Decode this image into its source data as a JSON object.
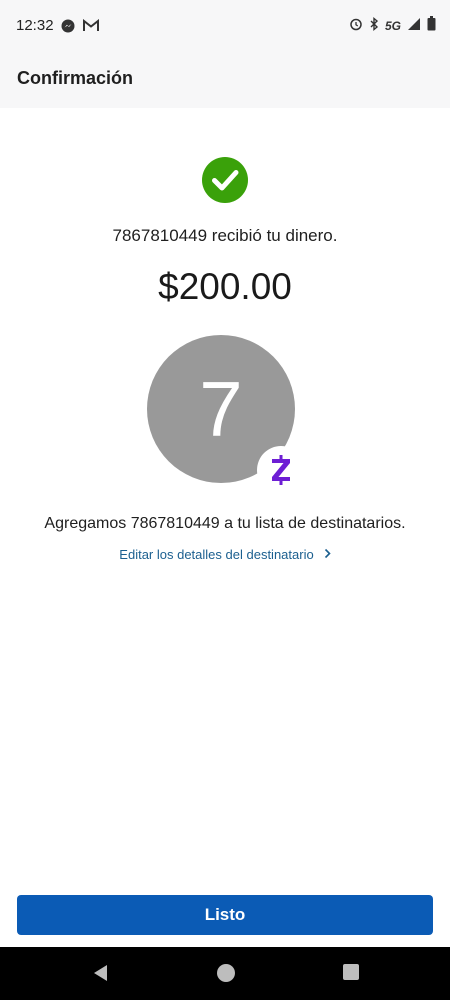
{
  "status_bar": {
    "time": "12:32",
    "left_icons": [
      "messenger-icon",
      "gmail-icon"
    ],
    "network": "5G",
    "right_icons": [
      "alarm-icon",
      "bluetooth-icon",
      "signal-icon",
      "battery-icon"
    ]
  },
  "header": {
    "title": "Confirmación"
  },
  "confirmation": {
    "icon": "check-circle-icon",
    "received_text": "7867810449 recibió tu dinero.",
    "amount": "$200.00",
    "avatar_initial": "7",
    "badge_icon": "zelle-icon",
    "added_text": "Agregamos 7867810449 a tu lista de destinatarios.",
    "edit_link_label": "Editar los detalles del destinatario"
  },
  "footer": {
    "done_label": "Listo"
  },
  "colors": {
    "success": "#3aa10a",
    "primary_button": "#0b5bb5",
    "link": "#1b5f8f",
    "zelle": "#6d1ed4",
    "avatar": "#999999"
  }
}
